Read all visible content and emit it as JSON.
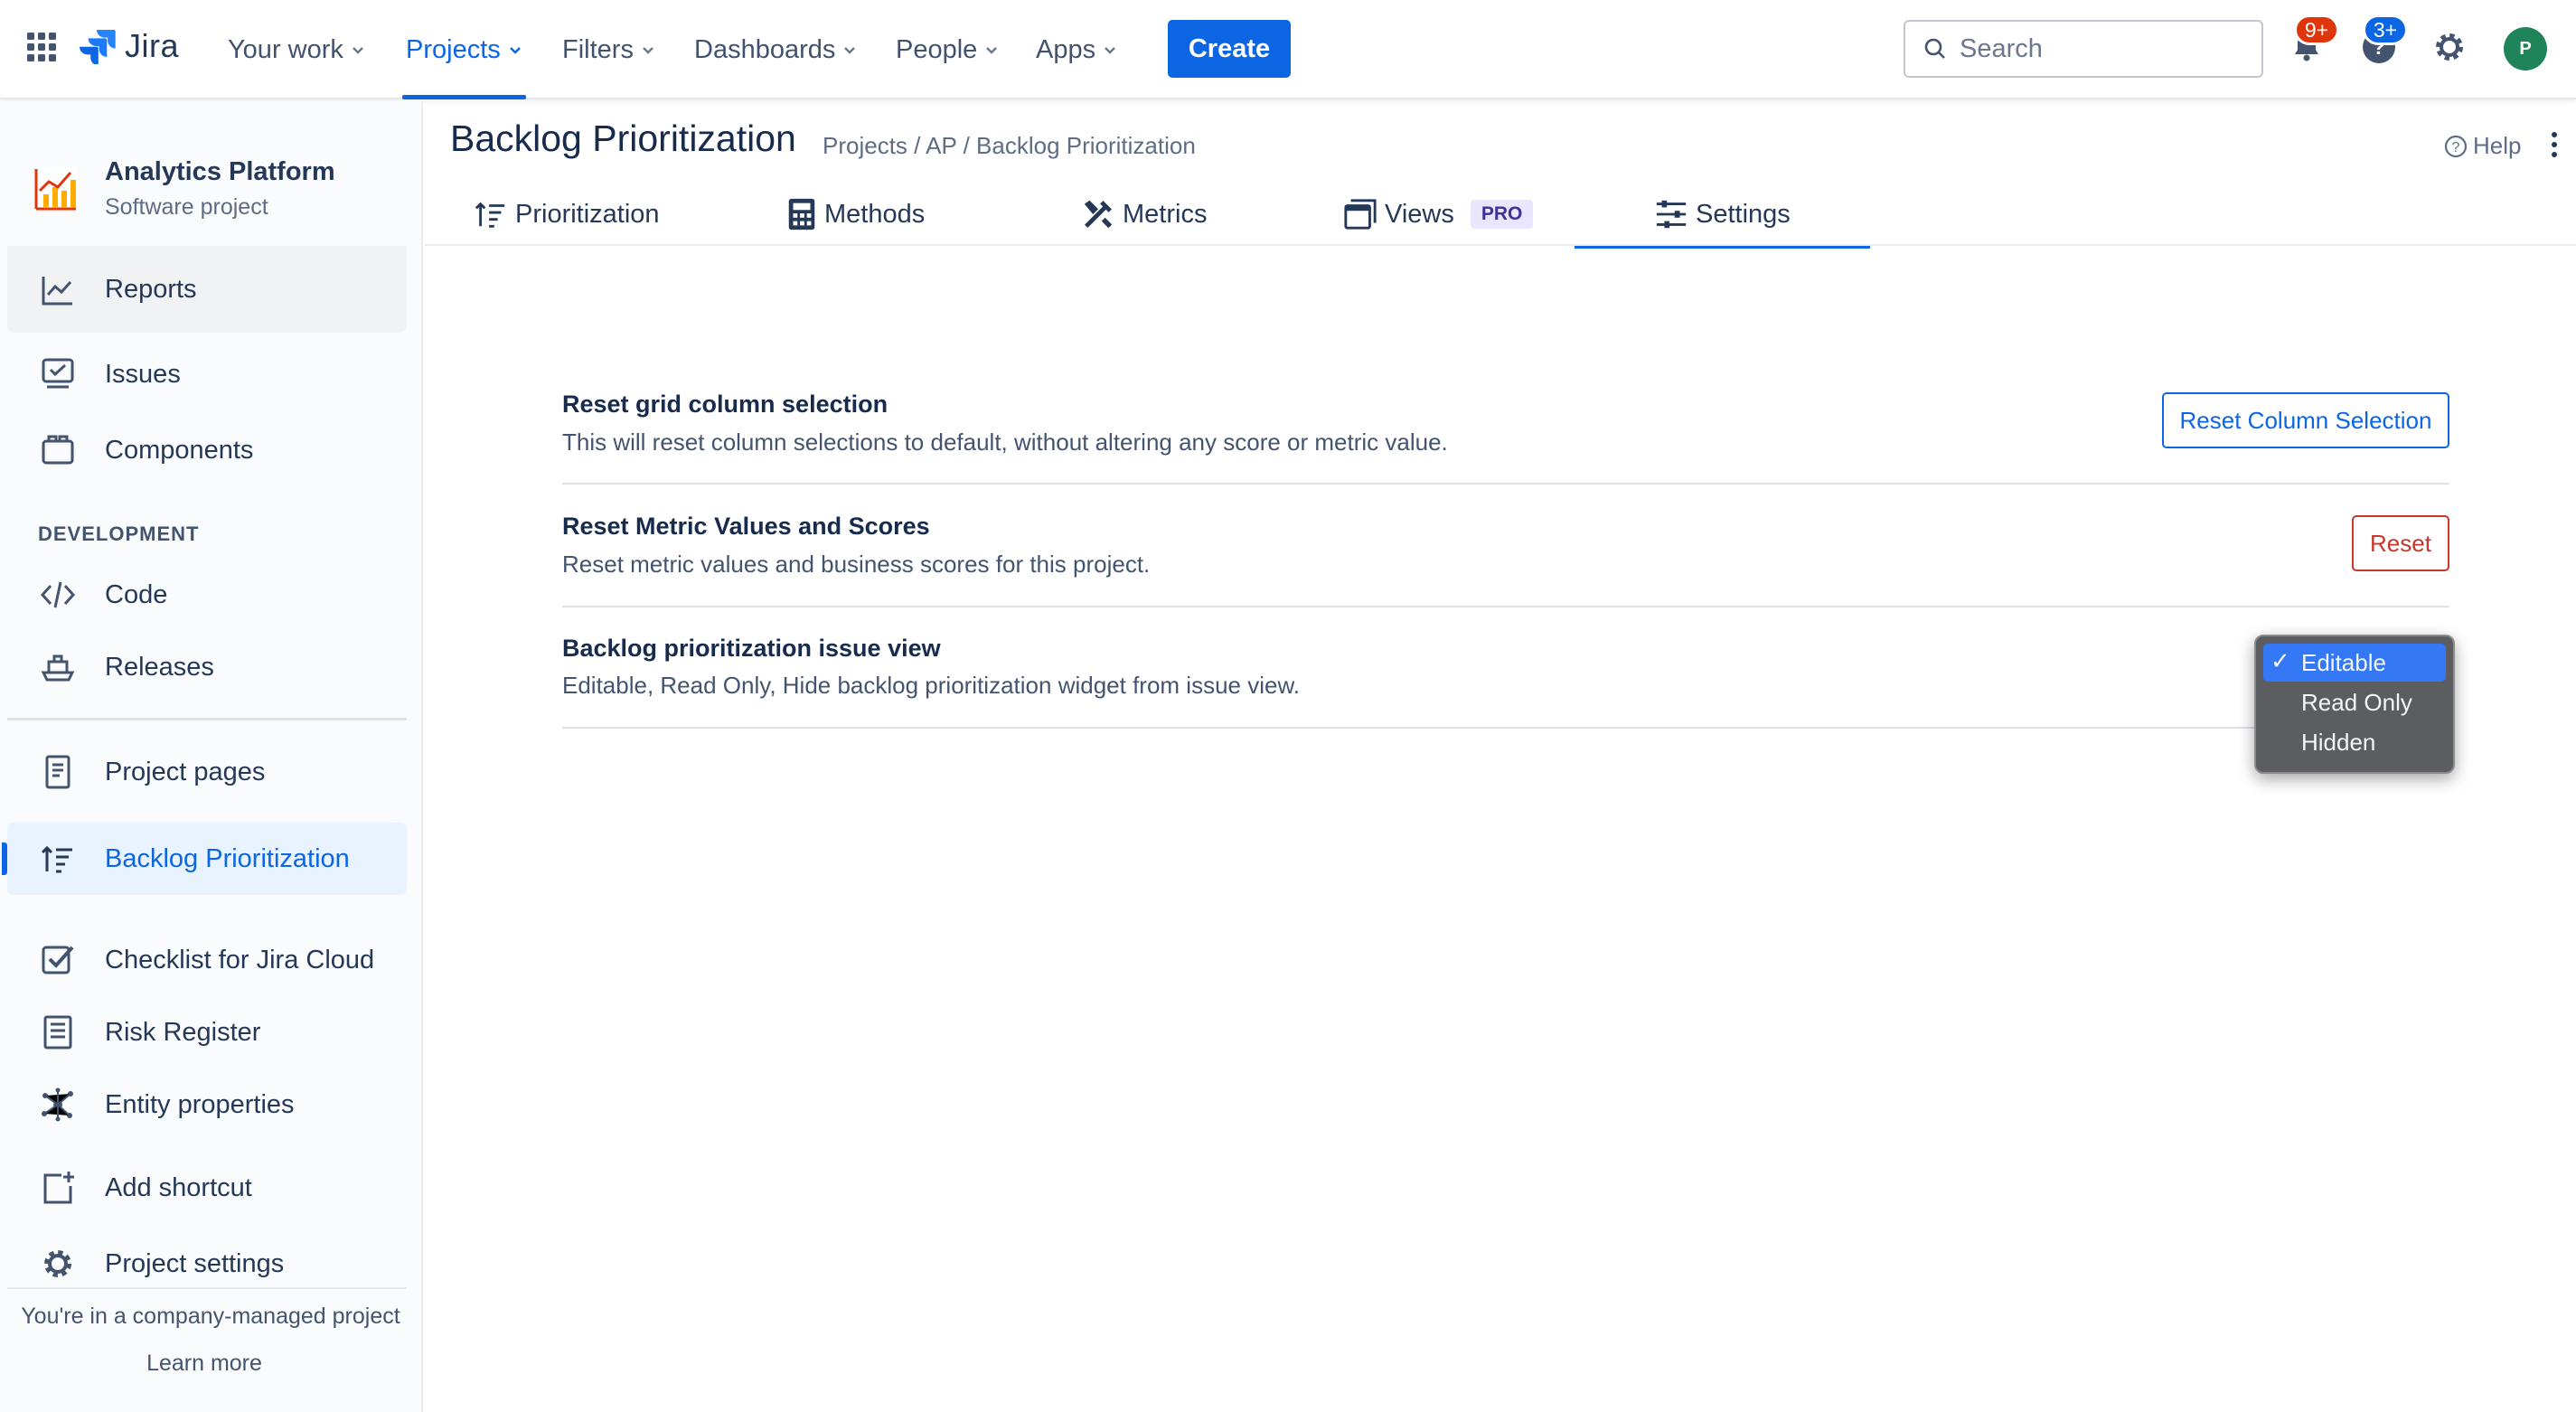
{
  "topnav": {
    "logo_text": "Jira",
    "items": [
      {
        "label": "Your work"
      },
      {
        "label": "Projects"
      },
      {
        "label": "Filters"
      },
      {
        "label": "Dashboards"
      },
      {
        "label": "People"
      },
      {
        "label": "Apps"
      }
    ],
    "active_item": "Projects",
    "create_label": "Create",
    "search_placeholder": "Search",
    "notifications_badge": "9+",
    "help_badge": "3+",
    "avatar_initial": "P",
    "accent_color": "#0c66e4"
  },
  "sidebar": {
    "project_name": "Analytics Platform",
    "project_type": "Software project",
    "items": [
      {
        "label": "Reports",
        "icon": "chart-line-icon"
      },
      {
        "label": "Issues",
        "icon": "issues-icon"
      },
      {
        "label": "Components",
        "icon": "components-icon"
      },
      {
        "label": "Code",
        "icon": "code-icon"
      },
      {
        "label": "Releases",
        "icon": "ship-icon"
      },
      {
        "label": "Project pages",
        "icon": "page-icon"
      },
      {
        "label": "Backlog Prioritization",
        "icon": "sort-icon"
      },
      {
        "label": "Checklist for Jira Cloud",
        "icon": "checkbox-icon"
      },
      {
        "label": "Risk Register",
        "icon": "book-icon"
      },
      {
        "label": "Entity properties",
        "icon": "nodes-icon"
      },
      {
        "label": "Add shortcut",
        "icon": "add-shortcut-icon"
      },
      {
        "label": "Project settings",
        "icon": "gear-icon"
      }
    ],
    "section_development": "DEVELOPMENT",
    "active_item": "Backlog Prioritization",
    "footer_text": "You're in a company-managed project",
    "learn_more": "Learn more"
  },
  "header": {
    "title": "Backlog Prioritization",
    "breadcrumb": "Projects / AP / Backlog Prioritization",
    "help_label": "Help"
  },
  "tabs": [
    {
      "label": "Prioritization",
      "icon": "sort-icon"
    },
    {
      "label": "Methods",
      "icon": "calculator-icon"
    },
    {
      "label": "Metrics",
      "icon": "tools-icon"
    },
    {
      "label": "Views",
      "icon": "windows-icon",
      "badge": "PRO"
    },
    {
      "label": "Settings",
      "icon": "sliders-icon"
    }
  ],
  "active_tab": "Settings",
  "settings": {
    "rows": [
      {
        "title": "Reset grid column selection",
        "description": "This will reset column selections to default, without altering any score or metric value.",
        "action_label": "Reset Column Selection"
      },
      {
        "title": "Reset Metric Values and Scores",
        "description": "Reset metric values and business scores for this project.",
        "action_label": "Reset"
      },
      {
        "title": "Backlog prioritization issue view",
        "description": "Editable, Read Only, Hide backlog prioritization widget from issue view."
      }
    ],
    "issue_view_options": [
      "Editable",
      "Read Only",
      "Hidden"
    ],
    "issue_view_selected": "Editable",
    "check_mark": "✓"
  }
}
